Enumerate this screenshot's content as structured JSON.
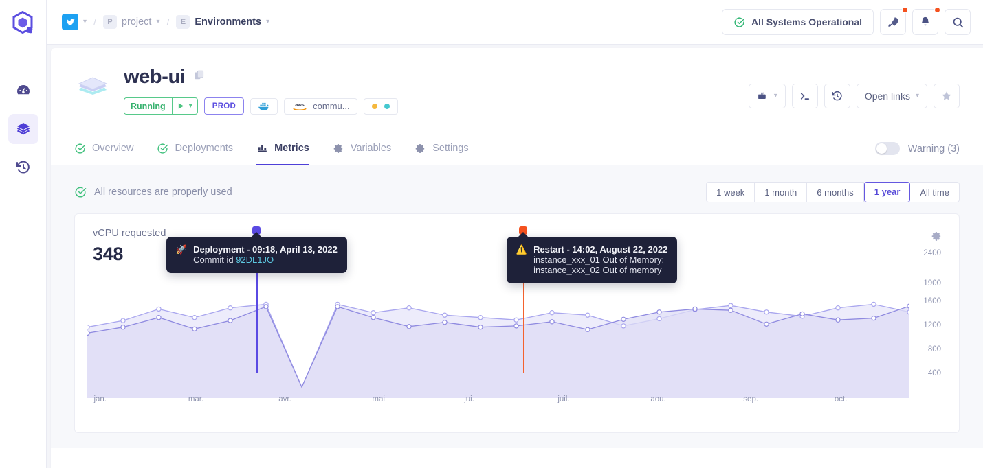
{
  "brand": {
    "logo_name": "qovery-logo"
  },
  "sidebar": {
    "items": [
      {
        "name": "dashboard",
        "icon": "gauge-icon",
        "active": false
      },
      {
        "name": "environments",
        "icon": "layers-icon",
        "active": true
      },
      {
        "name": "history",
        "icon": "clock-history-icon",
        "active": false
      }
    ]
  },
  "topbar": {
    "breadcrumb": [
      {
        "chip": "",
        "icon": "twitter-icon",
        "label": "",
        "caret": "⌄"
      },
      {
        "chip": "P",
        "label": "project",
        "caret": "⌄"
      },
      {
        "chip": "E",
        "label": "Environments",
        "caret": "⌄"
      }
    ],
    "separator": "/",
    "status_label": "All Systems Operational",
    "status_icon": "check-circle-icon",
    "status_color": "#2fb673",
    "buttons": [
      {
        "name": "rocket-icon",
        "badge": true
      },
      {
        "name": "bell-icon",
        "badge": true
      },
      {
        "name": "search-icon",
        "badge": false
      }
    ],
    "badge_color": "#f4511e"
  },
  "project": {
    "icon": "layers-3d-icon",
    "title": "web-ui",
    "copy_icon": "copy-icon",
    "badges": {
      "status_label": "Running",
      "status_color": "#35b16d",
      "play_icon": "play-icon",
      "play_caret": "⌄",
      "env_label": "PROD",
      "env_color": "#5b4ee0",
      "docker_icon": "docker-icon",
      "cloud_icon": "aws-icon",
      "cloud_label": "commu...",
      "dots": [
        "#f5b83d",
        "#45c8cf"
      ]
    },
    "actions": [
      {
        "name": "deploy-menu-button",
        "icon": "deploy-icon",
        "label": "",
        "caret": "⌄"
      },
      {
        "name": "terminal-button",
        "icon": "terminal-icon",
        "label": ""
      },
      {
        "name": "logs-history-button",
        "icon": "clock-history-icon",
        "label": ""
      },
      {
        "name": "open-links-button",
        "icon": "",
        "label": "Open links",
        "caret": "⌄"
      },
      {
        "name": "favorite-button",
        "icon": "star-icon",
        "label": ""
      }
    ]
  },
  "tabs": [
    {
      "label": "Overview",
      "icon": "check-circle-icon",
      "active": false
    },
    {
      "label": "Deployments",
      "icon": "check-circle-icon",
      "active": false
    },
    {
      "label": "Metrics",
      "icon": "bar-chart-icon",
      "active": true
    },
    {
      "label": "Variables",
      "icon": "gear-icon",
      "active": false
    },
    {
      "label": "Settings",
      "icon": "gear-icon",
      "active": false
    }
  ],
  "warning_toggle": {
    "label": "Warning (3)",
    "enabled": false
  },
  "resources": {
    "icon": "check-circle-icon",
    "text": "All resources are properly used"
  },
  "time_ranges": [
    {
      "label": "1 week",
      "active": false
    },
    {
      "label": "1 month",
      "active": false
    },
    {
      "label": "6 months",
      "active": false
    },
    {
      "label": "1 year",
      "active": true
    },
    {
      "label": "All time",
      "active": false
    }
  ],
  "chart_card": {
    "metric_label": "vCPU requested",
    "metric_value": "348",
    "gear_icon": "gear-icon"
  },
  "events": [
    {
      "type": "deployment",
      "marker_color": "#5a4ae3",
      "line_color": "#5a4ae3",
      "icon": "rocket-emoji",
      "title": "Deployment - 09:18, April 13, 2022",
      "sub_prefix": "Commit id ",
      "sub_link": "92DL1JO",
      "x_pct": 20.6
    },
    {
      "type": "restart",
      "marker_color": "#f4511e",
      "line_color": "#f4622e",
      "icon": "warning-triangle-icon",
      "title": "Restart - 14:02, August 22, 2022",
      "sub_lines": [
        "instance_xxx_01 Out of Memory;",
        "instance_xxx_02 Out of memory"
      ],
      "x_pct": 53.0
    }
  ],
  "chart_data": {
    "type": "area",
    "title": "vCPU requested",
    "xlabel": "",
    "ylabel": "",
    "legend_position": "none",
    "grid": false,
    "ylim": [
      0,
      2650
    ],
    "yticks": [
      400,
      800,
      1200,
      1600,
      1900,
      2400
    ],
    "ytick_labels": [
      "400",
      "800",
      "1200",
      "1600",
      "1900",
      "2400"
    ],
    "xtick_labels": [
      "jan.",
      "mar.",
      "avr.",
      "mai",
      "jui.",
      "juil.",
      "aou.",
      "sep.",
      "oct."
    ],
    "xtick_positions_pct": [
      0.8,
      12.4,
      23.5,
      35.0,
      46.3,
      57.8,
      69.2,
      80.6,
      91.8
    ],
    "series": [
      {
        "name": "upper",
        "color": "#a9a6ee",
        "fill": "#e7e6fa",
        "values": [
          1180,
          1290,
          1480,
          1340,
          1500,
          1560,
          180,
          1560,
          1420,
          1500,
          1380,
          1340,
          1300,
          1420,
          1380,
          1200,
          1320,
          1470,
          1540,
          1430,
          1360,
          1500,
          1560,
          1430
        ]
      },
      {
        "name": "lower",
        "color": "#8f8ae0",
        "fill": "#dedcf6",
        "values": [
          1080,
          1180,
          1340,
          1150,
          1290,
          1520,
          180,
          1520,
          1340,
          1190,
          1260,
          1180,
          1200,
          1270,
          1140,
          1310,
          1430,
          1480,
          1460,
          1230,
          1400,
          1300,
          1330,
          1530
        ]
      }
    ]
  }
}
